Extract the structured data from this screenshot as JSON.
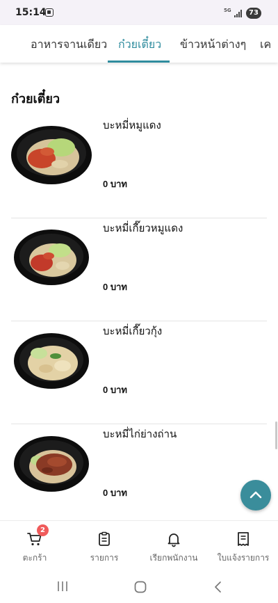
{
  "status_bar": {
    "time": "15:14",
    "network": "5G",
    "battery": "73"
  },
  "tabs": [
    {
      "label": "อาหารจานเดียว",
      "active": false
    },
    {
      "label": "ก๋วยเตี๋ยว",
      "active": true
    },
    {
      "label": "ข้าวหน้าต่างๆ",
      "active": false
    },
    {
      "label": "เค",
      "active": false
    }
  ],
  "section": {
    "title": "ก๋วยเตี๋ยว"
  },
  "items": [
    {
      "name": "บะหมี่หมูแดง",
      "price": "0 บาท",
      "image": "noodle-with-red-pork"
    },
    {
      "name": "บะหมี่เกี๊ยวหมูแดง",
      "price": "0 บาท",
      "image": "wonton-noodle-with-red-pork"
    },
    {
      "name": "บะหมี่เกี๊ยวกุ้ง",
      "price": "0 บาท",
      "image": "shrimp-wonton-noodle"
    },
    {
      "name": "บะหมี่ไก่ย่างถ่าน",
      "price": "0 บาท",
      "image": "charcoal-grilled-chicken-noodle"
    }
  ],
  "bottom_nav": [
    {
      "label": "ตะกร้า",
      "icon": "cart-icon",
      "badge": "2"
    },
    {
      "label": "รายการ",
      "icon": "clipboard-icon"
    },
    {
      "label": "เรียกพนักงาน",
      "icon": "bell-icon"
    },
    {
      "label": "ใบแจ้งรายการ",
      "icon": "receipt-icon"
    }
  ],
  "colors": {
    "accent": "#2f8c9e",
    "fab": "#3a8d9b",
    "badge": "#f05b5b"
  }
}
